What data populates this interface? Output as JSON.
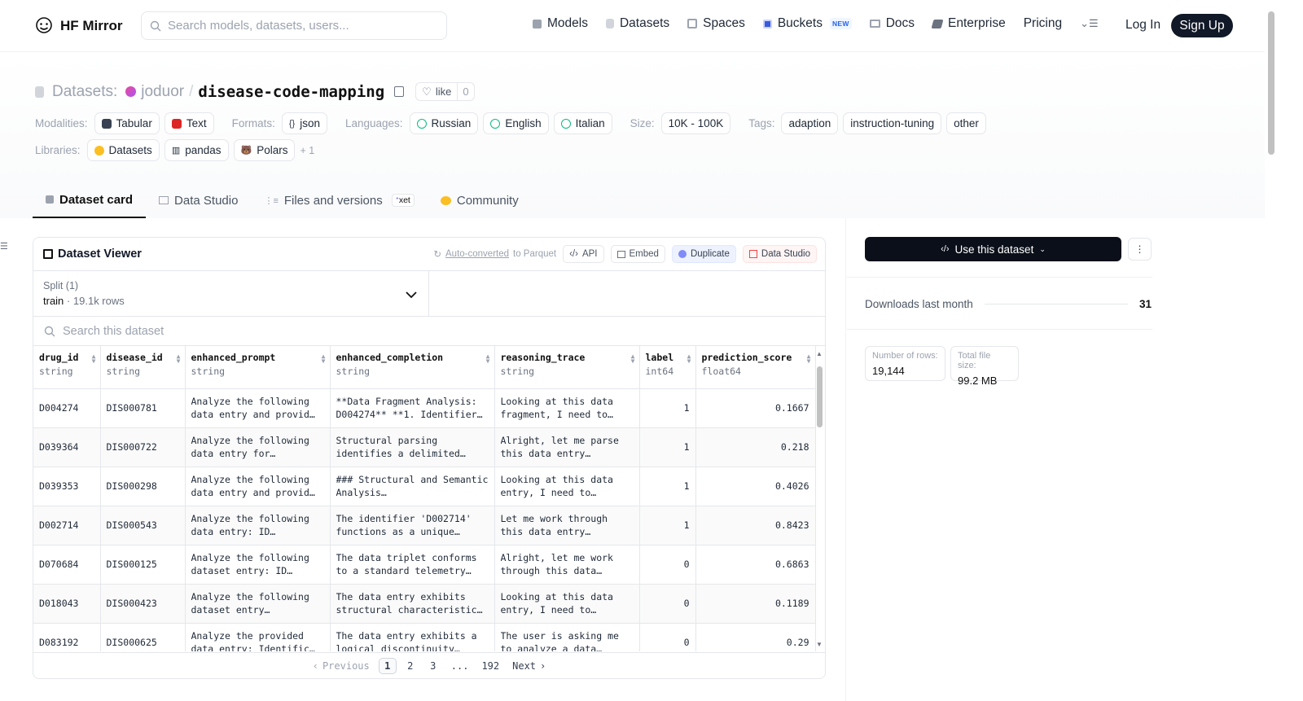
{
  "nav": {
    "brand": "HF Mirror",
    "search_placeholder": "Search models, datasets, users...",
    "links": [
      {
        "label": "Models",
        "icon": "cube-icon"
      },
      {
        "label": "Datasets",
        "icon": "database-icon"
      },
      {
        "label": "Spaces",
        "icon": "grid-icon"
      },
      {
        "label": "Buckets",
        "icon": "bucket-icon",
        "badge": "NEW"
      },
      {
        "label": "Docs",
        "icon": "book-icon"
      },
      {
        "label": "Enterprise",
        "icon": "enterprise-icon"
      },
      {
        "label": "Pricing"
      }
    ],
    "login": "Log In",
    "signup": "Sign Up"
  },
  "header": {
    "prefix": "Datasets:",
    "owner": "joduor",
    "separator": "/",
    "name": "disease-code-mapping",
    "like_label": "like",
    "like_count": "0"
  },
  "meta": {
    "modalities_label": "Modalities:",
    "modalities": [
      "Tabular",
      "Text"
    ],
    "formats_label": "Formats:",
    "formats": [
      "json"
    ],
    "languages_label": "Languages:",
    "languages": [
      "Russian",
      "English",
      "Italian"
    ],
    "size_label": "Size:",
    "size": "10K - 100K",
    "tags_label": "Tags:",
    "tags": [
      "adaption",
      "instruction-tuning",
      "other"
    ],
    "libraries_label": "Libraries:",
    "libraries": [
      "Datasets",
      "pandas",
      "Polars"
    ],
    "libraries_more": "+ 1"
  },
  "tabs": [
    {
      "label": "Dataset card",
      "active": true
    },
    {
      "label": "Data Studio"
    },
    {
      "label": "Files and versions",
      "badge": "xet"
    },
    {
      "label": "Community"
    }
  ],
  "viewer": {
    "title": "Dataset Viewer",
    "auto_link": "Auto-converted",
    "auto_rest": "to Parquet",
    "buttons": [
      "API",
      "Embed",
      "Duplicate",
      "Data Studio"
    ],
    "split_label": "Split (1)",
    "split_name": "train",
    "split_dot": "·",
    "split_rows": "19.1k rows",
    "search_placeholder": "Search this dataset",
    "columns": [
      {
        "name": "drug_id",
        "type": "string"
      },
      {
        "name": "disease_id",
        "type": "string"
      },
      {
        "name": "enhanced_prompt",
        "type": "string"
      },
      {
        "name": "enhanced_completion",
        "type": "string"
      },
      {
        "name": "reasoning_trace",
        "type": "string"
      },
      {
        "name": "label",
        "type": "int64"
      },
      {
        "name": "prediction_score",
        "type": "float64"
      }
    ],
    "rows": [
      [
        "D004274",
        "DIS000781",
        "Analyze the following data entry and provid…",
        "**Data Fragment Analysis: D004274** **1. Identifier…",
        "Looking at this data fragment, I need to…",
        "1",
        "0.1667"
      ],
      [
        "D039364",
        "DIS000722",
        "Analyze the following data entry for…",
        "Structural parsing identifies a delimited…",
        "Alright, let me parse this data entry…",
        "1",
        "0.218"
      ],
      [
        "D039353",
        "DIS000298",
        "Analyze the following data entry and provid…",
        "### Structural and Semantic Analysis…",
        "Looking at this data entry, I need to…",
        "1",
        "0.4026"
      ],
      [
        "D002714",
        "DIS000543",
        "Analyze the following data entry: ID…",
        "The identifier 'D002714' functions as a unique…",
        "Let me work through this data entry…",
        "1",
        "0.8423"
      ],
      [
        "D070684",
        "DIS000125",
        "Analyze the following dataset entry: ID…",
        "The data triplet conforms to a standard telemetry…",
        "Alright, let me work through this data…",
        "0",
        "0.6863"
      ],
      [
        "D018043",
        "DIS000423",
        "Analyze the following dataset entry…",
        "The data entry exhibits structural characteristic…",
        "Looking at this data entry, I need to…",
        "0",
        "0.1189"
      ],
      [
        "D083192",
        "DIS000625",
        "Analyze the provided data entry: Identific…",
        "The data entry exhibits a logical discontinuity…",
        "The user is asking me to analyze a data…",
        "0",
        "0.29"
      ]
    ],
    "pager": {
      "prev": "Previous",
      "pages": [
        "1",
        "2",
        "3",
        "...",
        "192"
      ],
      "current": "1",
      "next": "Next"
    }
  },
  "sidebar": {
    "use_button": "Use this dataset",
    "downloads_label": "Downloads last month",
    "downloads_value": "31",
    "stats": [
      {
        "label": "Number of rows:",
        "value": "19,144"
      },
      {
        "label": "Total file size:",
        "value": "99.2 MB"
      }
    ]
  },
  "colors": {
    "primary_dark": "#0b0f19",
    "border": "#e5e7eb",
    "muted": "#9ca3af"
  }
}
